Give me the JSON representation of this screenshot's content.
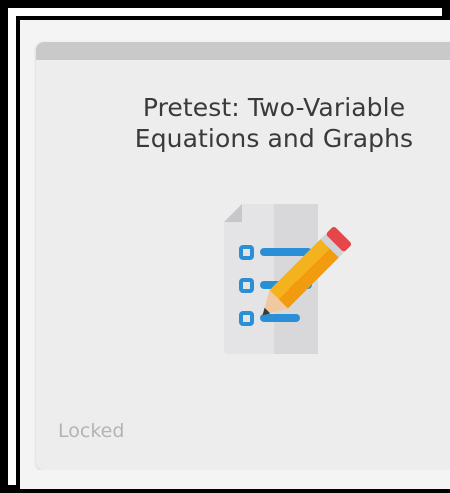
{
  "card": {
    "title_line1": "Pretest: Two-Variable",
    "title_line2": "Equations and Graphs",
    "status": "Locked",
    "icon": "checklist-pencil-icon"
  },
  "colors": {
    "card_background": "#ededed",
    "title_text": "#3a3a3a",
    "status_text": "#b4b4b4",
    "icon_blue": "#2b8fd6",
    "pencil_yellow": "#f5b21f",
    "pencil_red": "#e5464a"
  }
}
